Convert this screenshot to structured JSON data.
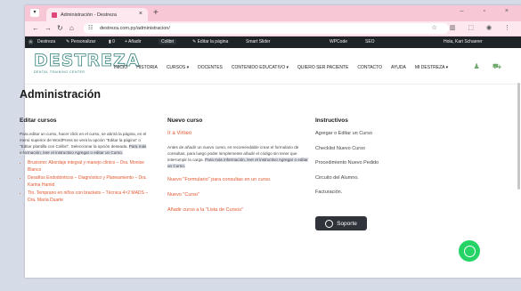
{
  "browser": {
    "tab_title": "Administración - Destreza",
    "tab_close": "×",
    "new_tab": "+",
    "url": "destreza.com.py/administracion/",
    "window_controls": "– ▫ ×",
    "nav_right": "☆ ▥ ⬚ ◉ ⋮"
  },
  "wpbar": {
    "items": [
      "Ⓦ",
      "Destreza",
      "✎ Personalizar",
      "▮ 0",
      "+ Añadir",
      "Colibri",
      "✎ Editar la página",
      "Smart Slider",
      "WPCode",
      "SEO",
      "Hola, Kari Schaerer"
    ]
  },
  "site": {
    "logo": "DESTREZA",
    "logo_sub": "DENTAL TRAINING CENTER",
    "menu": [
      "INICIO",
      "HISTORIA",
      "CURSOS ▾",
      "DOCENTES",
      "CONTENIDO EDUCATIVO ▾",
      "QUIERO SER PACIENTE",
      "CONTACTO",
      "AYUDA",
      "MI DESTREZA ▾"
    ]
  },
  "page": {
    "title": "Administración",
    "col1": {
      "heading": "Editar cursos",
      "text": "Para editar un curso, hacer click en el curso, se abrirá la página, en el menú superior de WordPress se verá la opción \"Editar la página\" o \"Editar plantilla con Colibri\". Seleccionar la opción deseada.",
      "text_hl": "Para más información, leer el instructivo Agregar o editar un Curso.",
      "courses": [
        "Bruxismo: Abordaje integral y manejo clínico – Dra. Monise Blanco",
        "Desafíos Endodónticos – Diagnóstico y Planeamiento – Dra. Karina Hamid",
        "Tto. Temprano en niños con brackets – Técnica 4×2 MADS – Dra. María Duarte"
      ]
    },
    "col2": {
      "heading": "Nuevo curso",
      "vimeo": "Ir a Vimeo",
      "text": "Antes de añadir un nuevo curso, es recomendable crear el formulario de consultas, para luego poder simplemente añadir el código sin tener que interrumpir la carga.",
      "text_hl": "Para más información, leer el instructivo Agregar o editar un Curso.",
      "links": [
        "Nuevo \"Formulario\" para consultas en un curso.",
        "Nuevo \"Curso\"",
        "Añadir curso a la \"Lista de Cursos\""
      ]
    },
    "col3": {
      "heading": "Instructivos",
      "items": [
        "Agregar o Editar un Curso",
        "Checklist Nuevo Curso",
        "Procedimiento Nuevo Pedido",
        "Circuito del Alumno.",
        "Facturación."
      ],
      "button": "Soporte"
    }
  }
}
